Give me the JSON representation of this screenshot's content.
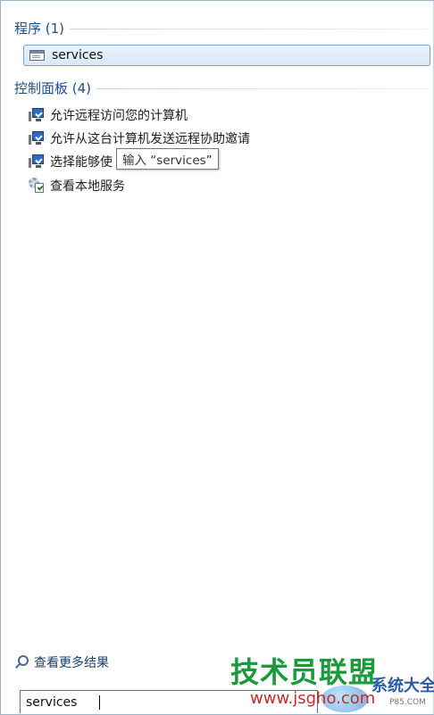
{
  "programs": {
    "header": "程序 (1)",
    "items": [
      {
        "label": "services",
        "icon": "services-app-icon"
      }
    ]
  },
  "control_panel": {
    "header": "控制面板 (4)",
    "items": [
      {
        "label": "允许远程访问您的计算机",
        "icon": "remote-monitor-icon"
      },
      {
        "label": "允许从这台计算机发送远程协助邀请",
        "icon": "remote-monitor-icon"
      },
      {
        "label": "选择能够使",
        "icon": "remote-monitor-icon"
      },
      {
        "label": "查看本地服务",
        "icon": "services-gear-icon"
      }
    ]
  },
  "tooltip": {
    "text": "输入 “services”"
  },
  "more_results": {
    "label": "查看更多结果",
    "icon": "search-icon"
  },
  "search": {
    "value": "services"
  },
  "watermark": {
    "main": "技术员联盟",
    "url": "www.jsgho.com",
    "side": "系统大全",
    "tiny": "P85.COM"
  },
  "colors": {
    "group_header": "#1e4e8c",
    "selection_border": "#7da2ce",
    "selection_fill": "#d9e8f8",
    "watermark_green": "#1a9a3a",
    "watermark_red": "#c82a2a"
  }
}
